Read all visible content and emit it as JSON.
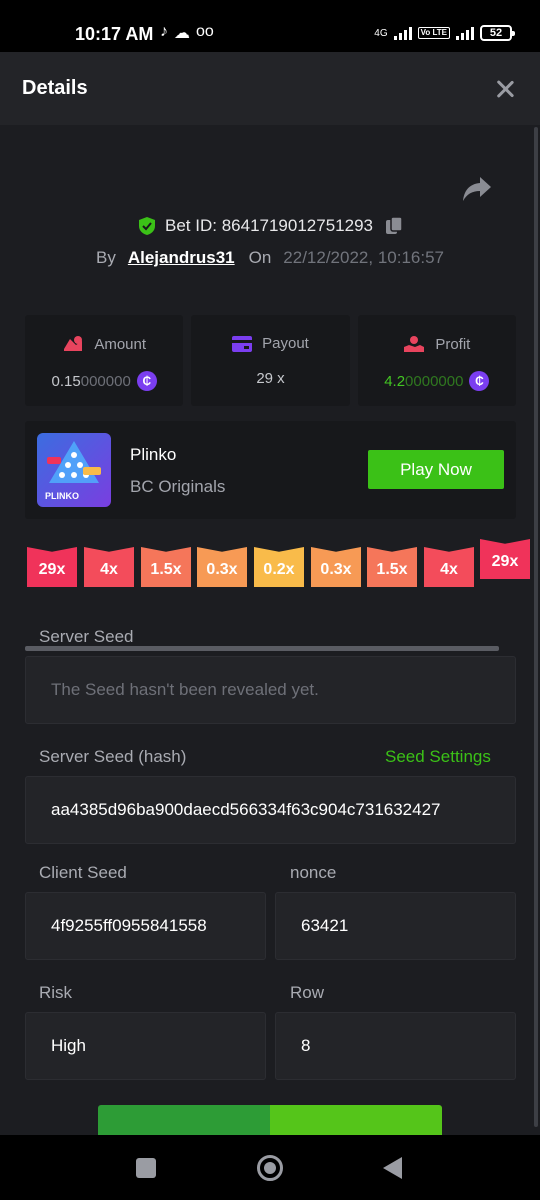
{
  "status_bar": {
    "time": "10:17 AM",
    "network": "4G",
    "lte": "Vo LTE",
    "battery": "52"
  },
  "header": {
    "title": "Details"
  },
  "bet": {
    "id_label": "Bet ID: 8641719012751293",
    "by_label": "By",
    "username": "Alejandrus31",
    "on_label": "On",
    "datetime": "22/12/2022, 10:16:57"
  },
  "stats": {
    "amount": {
      "label": "Amount",
      "value_bright": "0.15",
      "value_dim": "000000"
    },
    "payout": {
      "label": "Payout",
      "value": "29 x"
    },
    "profit": {
      "label": "Profit",
      "value_bright": "4.2",
      "value_dim": "0000000"
    }
  },
  "game": {
    "name": "Plinko",
    "provider": "BC Originals",
    "play_label": "Play Now",
    "thumb_text": "PLINKO"
  },
  "multipliers": [
    {
      "label": "29x",
      "color": "#f0335a"
    },
    {
      "label": "4x",
      "color": "#f34c5b"
    },
    {
      "label": "1.5x",
      "color": "#f5765a"
    },
    {
      "label": "0.3x",
      "color": "#f79a55"
    },
    {
      "label": "0.2x",
      "color": "#f9bb4a"
    },
    {
      "label": "0.3x",
      "color": "#f79a55"
    },
    {
      "label": "1.5x",
      "color": "#f5765a"
    },
    {
      "label": "4x",
      "color": "#f34c5b"
    },
    {
      "label": "29x",
      "color": "#f0335a"
    }
  ],
  "form": {
    "server_seed_label": "Server Seed",
    "server_seed_value": "The Seed hasn't been revealed yet.",
    "server_hash_label": "Server Seed (hash)",
    "seed_settings_label": "Seed Settings",
    "server_hash_value": "aa4385d96ba900daecd566334f63c904c731632427",
    "client_seed_label": "Client Seed",
    "client_seed_value": "4f9255ff0955841558",
    "nonce_label": "nonce",
    "nonce_value": "63421",
    "risk_label": "Risk",
    "risk_value": "High",
    "row_label": "Row",
    "row_value": "8"
  },
  "colors": {
    "accent_green": "#3bc117",
    "coin_purple": "#7b3ef0",
    "panel": "#17181b",
    "background": "#1c1d21"
  }
}
